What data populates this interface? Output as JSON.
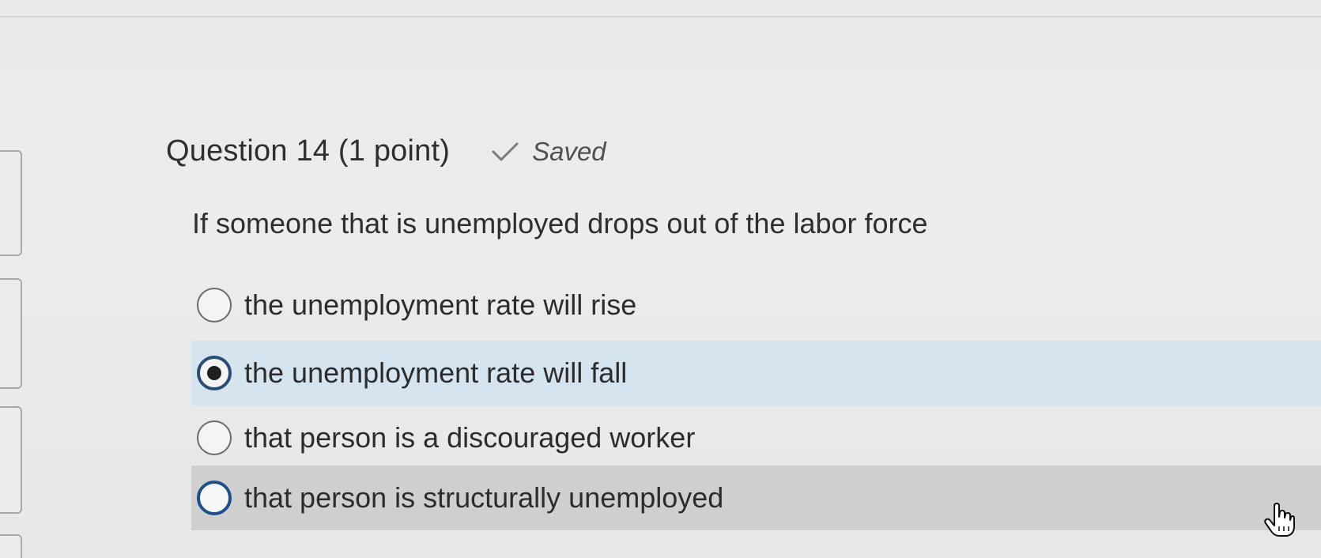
{
  "question": {
    "title": "Question 14 (1 point)",
    "status": "Saved",
    "status_icon": "check-icon",
    "prompt": "If someone that is unemployed drops out of the labor force"
  },
  "options": [
    {
      "label": "the unemployment rate will rise",
      "selected": false
    },
    {
      "label": "the unemployment rate will fall",
      "selected": true
    },
    {
      "label": "that person is a discouraged worker",
      "selected": false
    },
    {
      "label": "that person is structurally unemployed",
      "selected": false,
      "hovered": true
    }
  ],
  "colors": {
    "selected_row": "#d6e4ef",
    "hovered_row": "#cfcfcf",
    "radio_selected_ring": "#2a4d74"
  },
  "cursor": "hand-pointer-icon"
}
